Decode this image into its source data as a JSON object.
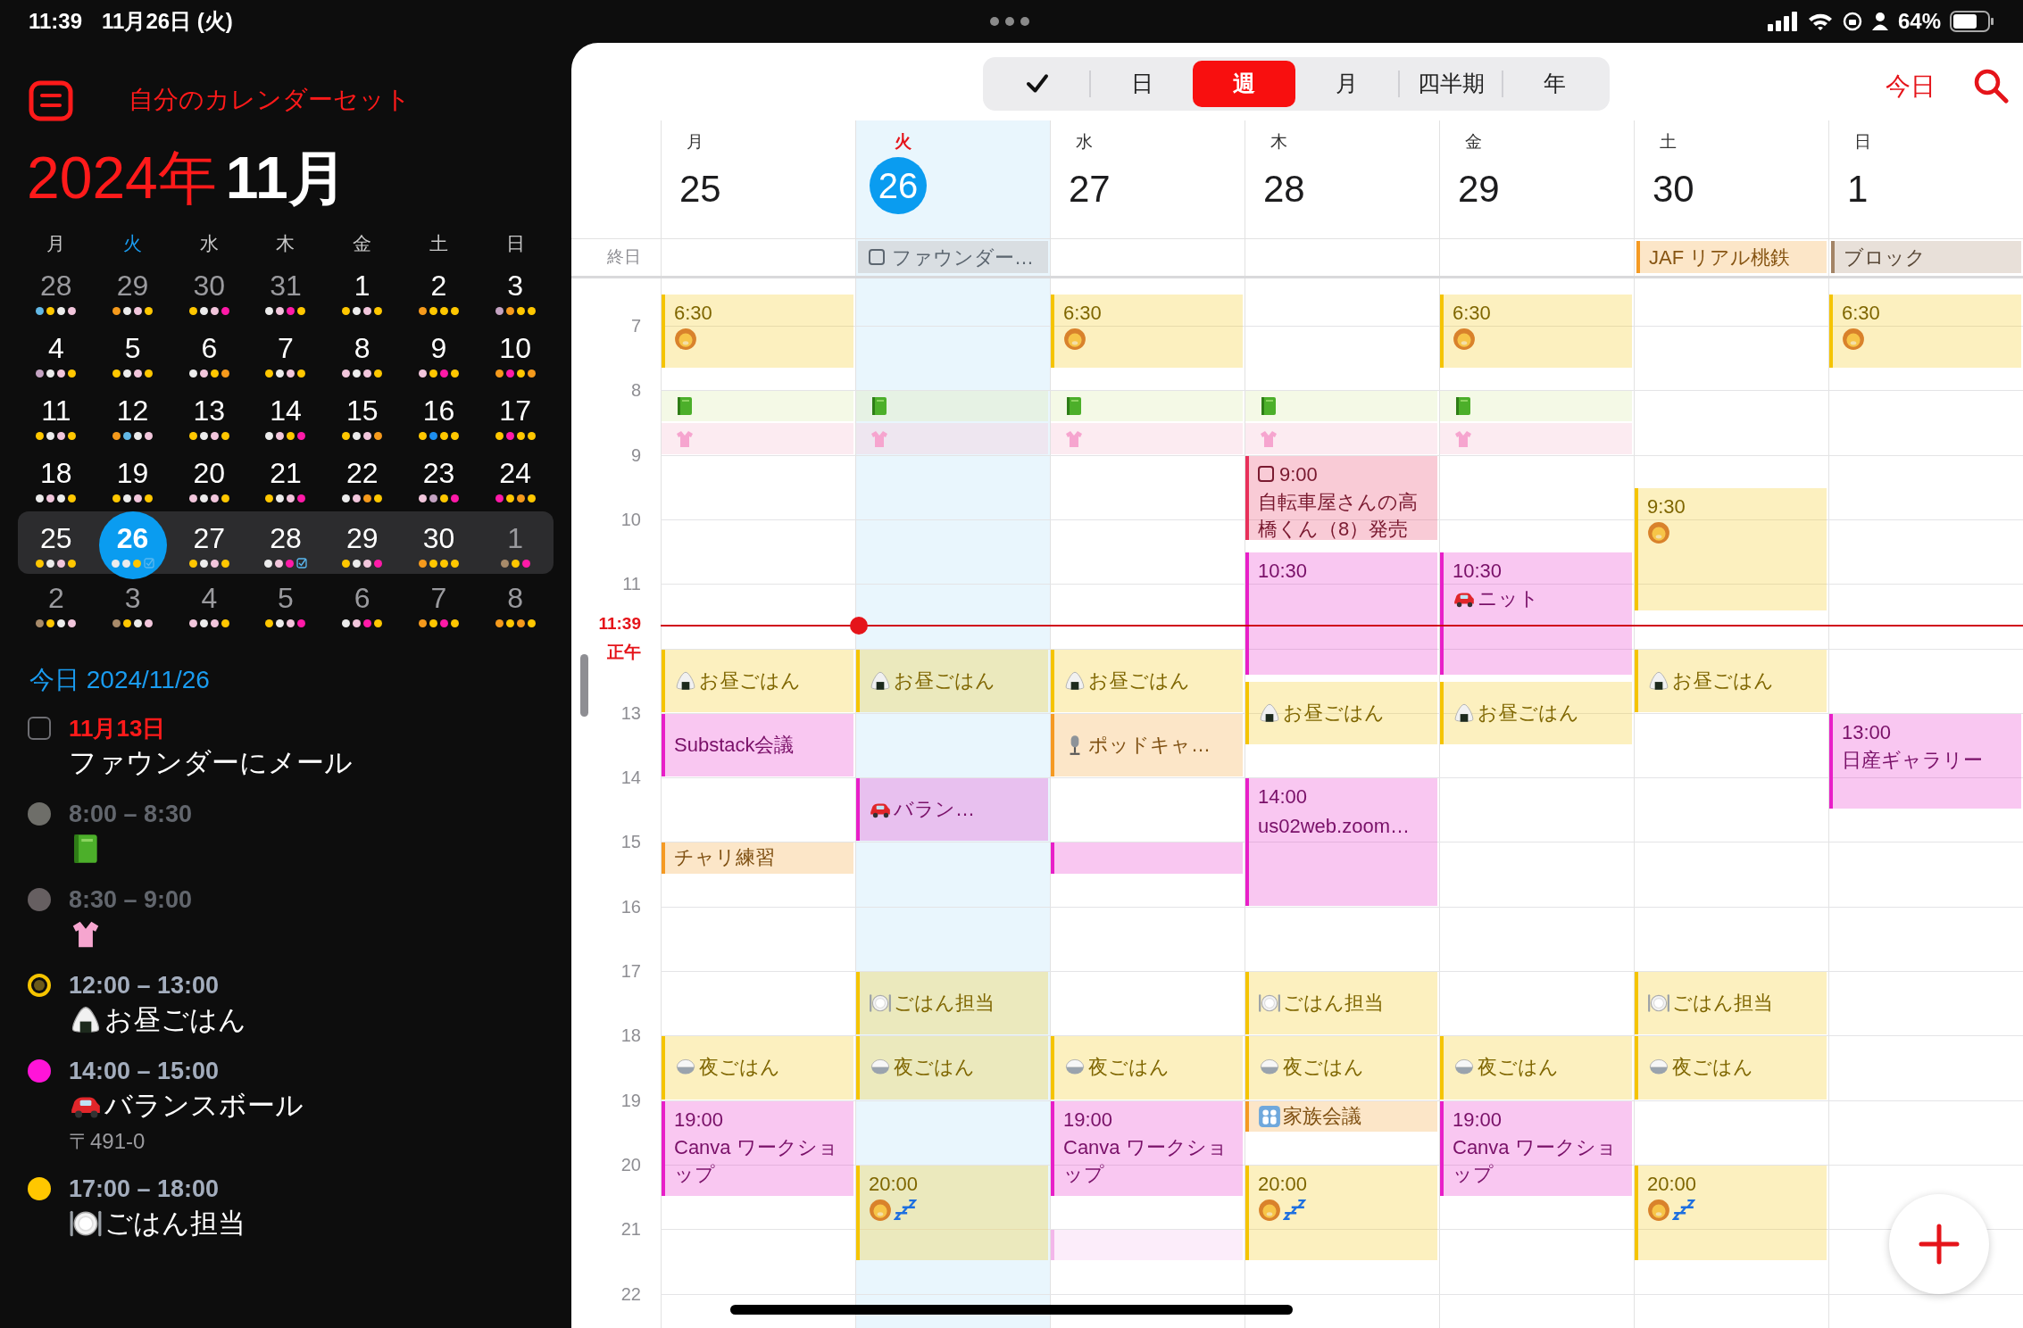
{
  "status_bar": {
    "time": "11:39",
    "date": "11月26日 (火)",
    "battery": "64%"
  },
  "sidebar": {
    "calendar_set": "自分のカレンダーセット",
    "year": "2024年",
    "month": "11月",
    "weekdays": [
      {
        "label": "月",
        "today": false
      },
      {
        "label": "火",
        "today": true
      },
      {
        "label": "水",
        "today": false
      },
      {
        "label": "木",
        "today": false
      },
      {
        "label": "金",
        "today": false
      },
      {
        "label": "土",
        "today": false
      },
      {
        "label": "日",
        "today": false
      }
    ],
    "weeks": [
      {
        "selected": false,
        "days": [
          {
            "label": "28",
            "other_month": true,
            "today": false,
            "task": false,
            "dots": [
              {
                "color": "#62b8e6"
              },
              {
                "color": "#ffc700"
              },
              {
                "color": "#ececec"
              },
              {
                "color": "#f2c6dc"
              }
            ]
          },
          {
            "label": "29",
            "other_month": true,
            "today": false,
            "task": false,
            "dots": [
              {
                "color": "#f59a1c"
              },
              {
                "color": "#ececec"
              },
              {
                "color": "#f2c6dc"
              },
              {
                "color": "#ffc700"
              }
            ]
          },
          {
            "label": "30",
            "other_month": true,
            "today": false,
            "task": false,
            "dots": [
              {
                "color": "#ffc700"
              },
              {
                "color": "#ececec"
              },
              {
                "color": "#f2c6dc"
              },
              {
                "color": "#ff1aa8"
              }
            ]
          },
          {
            "label": "31",
            "other_month": true,
            "today": false,
            "task": false,
            "dots": [
              {
                "color": "#ececec"
              },
              {
                "color": "#f2c6dc"
              },
              {
                "color": "#ff1aa8"
              },
              {
                "color": "#ffc700"
              }
            ]
          },
          {
            "label": "1",
            "other_month": false,
            "today": false,
            "task": false,
            "dots": [
              {
                "color": "#ffc700"
              },
              {
                "color": "#ececec"
              },
              {
                "color": "#f2c6dc"
              },
              {
                "color": "#ffc700"
              }
            ]
          },
          {
            "label": "2",
            "other_month": false,
            "today": false,
            "task": false,
            "dots": [
              {
                "color": "#f59a1c"
              },
              {
                "color": "#ffc700"
              },
              {
                "color": "#ffc700"
              },
              {
                "color": "#ffc700"
              }
            ]
          },
          {
            "label": "3",
            "other_month": false,
            "today": false,
            "task": false,
            "dots": [
              {
                "color": "#c4a3c2"
              },
              {
                "color": "#f59a1c"
              },
              {
                "color": "#ffc700"
              },
              {
                "color": "#ffc700"
              }
            ]
          }
        ]
      },
      {
        "selected": false,
        "days": [
          {
            "label": "4",
            "other_month": false,
            "today": false,
            "task": false,
            "dots": [
              {
                "color": "#c4a3c2"
              },
              {
                "color": "#ececec"
              },
              {
                "color": "#f2c6dc"
              },
              {
                "color": "#ffc700"
              }
            ]
          },
          {
            "label": "5",
            "other_month": false,
            "today": false,
            "task": false,
            "dots": [
              {
                "color": "#ffc700"
              },
              {
                "color": "#ececec"
              },
              {
                "color": "#f2c6dc"
              },
              {
                "color": "#ffc700"
              }
            ]
          },
          {
            "label": "6",
            "other_month": false,
            "today": false,
            "task": false,
            "dots": [
              {
                "color": "#ececec"
              },
              {
                "color": "#f2c6dc"
              },
              {
                "color": "#ffc700"
              },
              {
                "color": "#f59a1c"
              }
            ]
          },
          {
            "label": "7",
            "other_month": false,
            "today": false,
            "task": false,
            "dots": [
              {
                "color": "#ffc700"
              },
              {
                "color": "#ececec"
              },
              {
                "color": "#f2c6dc"
              },
              {
                "color": "#ffc700"
              }
            ]
          },
          {
            "label": "8",
            "other_month": false,
            "today": false,
            "task": false,
            "dots": [
              {
                "color": "#f2c6dc"
              },
              {
                "color": "#ececec"
              },
              {
                "color": "#f2c6dc"
              },
              {
                "color": "#ffc700"
              }
            ]
          },
          {
            "label": "9",
            "other_month": false,
            "today": false,
            "task": false,
            "dots": [
              {
                "color": "#f2c6dc"
              },
              {
                "color": "#ffc700"
              },
              {
                "color": "#ff1aa8"
              },
              {
                "color": "#ffc700"
              }
            ]
          },
          {
            "label": "10",
            "other_month": false,
            "today": false,
            "task": false,
            "dots": [
              {
                "color": "#f59a1c"
              },
              {
                "color": "#ff1aa8"
              },
              {
                "color": "#ffc700"
              },
              {
                "color": "#f59a1c"
              }
            ]
          }
        ]
      },
      {
        "selected": false,
        "days": [
          {
            "label": "11",
            "other_month": false,
            "today": false,
            "task": false,
            "dots": [
              {
                "color": "#ffc700"
              },
              {
                "color": "#ececec"
              },
              {
                "color": "#f2c6dc"
              },
              {
                "color": "#ffc700"
              }
            ]
          },
          {
            "label": "12",
            "other_month": false,
            "today": false,
            "task": false,
            "dots": [
              {
                "color": "#f59a1c"
              },
              {
                "color": "#62b8e6"
              },
              {
                "color": "#ececec"
              },
              {
                "color": "#f2c6dc"
              }
            ]
          },
          {
            "label": "13",
            "other_month": false,
            "today": false,
            "task": false,
            "dots": [
              {
                "color": "#ffc700"
              },
              {
                "color": "#ececec"
              },
              {
                "color": "#f2c6dc"
              },
              {
                "color": "#ffc700"
              }
            ]
          },
          {
            "label": "14",
            "other_month": false,
            "today": false,
            "task": false,
            "dots": [
              {
                "color": "#ececec"
              },
              {
                "color": "#f2c6dc"
              },
              {
                "color": "#ffc700"
              },
              {
                "color": "#ff1aa8"
              }
            ]
          },
          {
            "label": "15",
            "other_month": false,
            "today": false,
            "task": false,
            "dots": [
              {
                "color": "#ffc700"
              },
              {
                "color": "#ececec"
              },
              {
                "color": "#f2c6dc"
              },
              {
                "color": "#f59a1c"
              }
            ]
          },
          {
            "label": "16",
            "other_month": false,
            "today": false,
            "task": false,
            "dots": [
              {
                "color": "#ffc700"
              },
              {
                "color": "#1e8ff0"
              },
              {
                "color": "#ffc700"
              },
              {
                "color": "#ffc700"
              }
            ]
          },
          {
            "label": "17",
            "other_month": false,
            "today": false,
            "task": false,
            "dots": [
              {
                "color": "#ffc700"
              },
              {
                "color": "#ff1aa8"
              },
              {
                "color": "#ffc700"
              },
              {
                "color": "#ffc700"
              }
            ]
          }
        ]
      },
      {
        "selected": false,
        "days": [
          {
            "label": "18",
            "other_month": false,
            "today": false,
            "task": false,
            "dots": [
              {
                "color": "#ececec"
              },
              {
                "color": "#f2c6dc"
              },
              {
                "color": "#ececec"
              },
              {
                "color": "#ffc700"
              }
            ]
          },
          {
            "label": "19",
            "other_month": false,
            "today": false,
            "task": false,
            "dots": [
              {
                "color": "#ffc700"
              },
              {
                "color": "#ececec"
              },
              {
                "color": "#f2c6dc"
              },
              {
                "color": "#ffc700"
              }
            ]
          },
          {
            "label": "20",
            "other_month": false,
            "today": false,
            "task": false,
            "dots": [
              {
                "color": "#f2c6dc"
              },
              {
                "color": "#ececec"
              },
              {
                "color": "#f2c6dc"
              },
              {
                "color": "#ffc700"
              }
            ]
          },
          {
            "label": "21",
            "other_month": false,
            "today": false,
            "task": false,
            "dots": [
              {
                "color": "#ffc700"
              },
              {
                "color": "#ececec"
              },
              {
                "color": "#f2c6dc"
              },
              {
                "color": "#ff1aa8"
              }
            ]
          },
          {
            "label": "22",
            "other_month": false,
            "today": false,
            "task": false,
            "dots": [
              {
                "color": "#ececec"
              },
              {
                "color": "#f2c6dc"
              },
              {
                "color": "#f59a1c"
              },
              {
                "color": "#ffc700"
              }
            ]
          },
          {
            "label": "23",
            "other_month": false,
            "today": false,
            "task": false,
            "dots": [
              {
                "color": "#f2c6dc"
              },
              {
                "color": "#c4a3c2"
              },
              {
                "color": "#ffc700"
              },
              {
                "color": "#ff1aa8"
              }
            ]
          },
          {
            "label": "24",
            "other_month": false,
            "today": false,
            "task": false,
            "dots": [
              {
                "color": "#ff1aa8"
              },
              {
                "color": "#ffc700"
              },
              {
                "color": "#f59a1c"
              },
              {
                "color": "#ffc700"
              }
            ]
          }
        ]
      },
      {
        "selected": true,
        "days": [
          {
            "label": "25",
            "other_month": false,
            "today": false,
            "task": false,
            "dots": [
              {
                "color": "#ffc700"
              },
              {
                "color": "#ececec"
              },
              {
                "color": "#f2c6dc"
              },
              {
                "color": "#ffc700"
              }
            ]
          },
          {
            "label": "26",
            "other_month": false,
            "today": true,
            "task": true,
            "dots": [
              {
                "color": "#ececec"
              },
              {
                "color": "#ececec"
              },
              {
                "color": "#ffc700"
              }
            ]
          },
          {
            "label": "27",
            "other_month": false,
            "today": false,
            "task": false,
            "dots": [
              {
                "color": "#ffc700"
              },
              {
                "color": "#ececec"
              },
              {
                "color": "#f2c6dc"
              },
              {
                "color": "#ffc700"
              }
            ]
          },
          {
            "label": "28",
            "other_month": false,
            "today": false,
            "task": true,
            "dots": [
              {
                "color": "#ececec"
              },
              {
                "color": "#f2c6dc"
              },
              {
                "color": "#ff1aa8"
              }
            ]
          },
          {
            "label": "29",
            "other_month": false,
            "today": false,
            "task": false,
            "dots": [
              {
                "color": "#ffc700"
              },
              {
                "color": "#ececec"
              },
              {
                "color": "#f2c6dc"
              },
              {
                "color": "#ff1aa8"
              }
            ]
          },
          {
            "label": "30",
            "other_month": false,
            "today": false,
            "task": false,
            "dots": [
              {
                "color": "#f59a1c"
              },
              {
                "color": "#ffc700"
              },
              {
                "color": "#ffc700"
              },
              {
                "color": "#ffc700"
              }
            ]
          },
          {
            "label": "1",
            "other_month": true,
            "today": false,
            "task": false,
            "dots": [
              {
                "color": "#a88b6a"
              },
              {
                "color": "#ffc700"
              },
              {
                "color": "#ff1aa8"
              }
            ]
          }
        ]
      },
      {
        "selected": false,
        "days": [
          {
            "label": "2",
            "other_month": true,
            "today": false,
            "task": false,
            "dots": [
              {
                "color": "#a88b6a"
              },
              {
                "color": "#ffc700"
              },
              {
                "color": "#ececec"
              },
              {
                "color": "#f2c6dc"
              }
            ]
          },
          {
            "label": "3",
            "other_month": true,
            "today": false,
            "task": false,
            "dots": [
              {
                "color": "#a88b6a"
              },
              {
                "color": "#ffc700"
              },
              {
                "color": "#ececec"
              },
              {
                "color": "#f2c6dc"
              }
            ]
          },
          {
            "label": "4",
            "other_month": true,
            "today": false,
            "task": false,
            "dots": [
              {
                "color": "#f2c6dc"
              },
              {
                "color": "#ececec"
              },
              {
                "color": "#f2c6dc"
              },
              {
                "color": "#ffc700"
              }
            ]
          },
          {
            "label": "5",
            "other_month": true,
            "today": false,
            "task": false,
            "dots": [
              {
                "color": "#ffc700"
              },
              {
                "color": "#ececec"
              },
              {
                "color": "#f2c6dc"
              },
              {
                "color": "#ff1aa8"
              }
            ]
          },
          {
            "label": "6",
            "other_month": true,
            "today": false,
            "task": false,
            "dots": [
              {
                "color": "#ececec"
              },
              {
                "color": "#f2c6dc"
              },
              {
                "color": "#ff1aa8"
              },
              {
                "color": "#ffc700"
              }
            ]
          },
          {
            "label": "7",
            "other_month": true,
            "today": false,
            "task": false,
            "dots": [
              {
                "color": "#f59a1c"
              },
              {
                "color": "#ffc700"
              },
              {
                "color": "#ff1aa8"
              },
              {
                "color": "#ffc700"
              }
            ]
          },
          {
            "label": "8",
            "other_month": true,
            "today": false,
            "task": false,
            "dots": [
              {
                "color": "#f59a1c"
              },
              {
                "color": "#ffc700"
              },
              {
                "color": "#f59a1c"
              },
              {
                "color": "#ffc700"
              }
            ]
          }
        ]
      }
    ],
    "agenda_header": "今日 2024/11/26",
    "agenda": [
      {
        "kind": "task",
        "checked": false,
        "date": "11月13日",
        "title": "ファウンダーにメール"
      },
      {
        "kind": "event",
        "time": "8:00 – 8:30",
        "color": "#6e6e69",
        "past": true,
        "current": false
      },
      {
        "kind": "event",
        "time": "8:30 – 9:00",
        "color": "#665f61",
        "past": true,
        "current": false
      },
      {
        "kind": "event",
        "time": "12:00 – 13:00",
        "color": "#f5c400",
        "past": false,
        "current": true,
        "title": "お昼ごはん"
      },
      {
        "kind": "event",
        "time": "14:00 – 15:00",
        "color": "#ff14d8",
        "past": false,
        "current": false,
        "title": "バランスボール",
        "location": "〒491-0"
      },
      {
        "kind": "event",
        "time": "17:00 – 18:00",
        "color": "#ffc700",
        "past": false,
        "current": false,
        "title": "ごはん担当"
      }
    ]
  },
  "toolbar": {
    "views": [
      {
        "kind": "icon",
        "selected": false
      },
      {
        "kind": "text",
        "label": "日",
        "selected": false
      },
      {
        "kind": "text",
        "label": "週",
        "selected": true
      },
      {
        "kind": "text",
        "label": "月",
        "selected": false
      },
      {
        "kind": "text",
        "label": "四半期",
        "selected": false
      },
      {
        "kind": "text",
        "label": "年",
        "selected": false
      }
    ],
    "today_button": "今日"
  },
  "week": {
    "all_day_label": "終日",
    "hours": [
      "7",
      "8",
      "9",
      "10",
      "11",
      "正午",
      "13",
      "14",
      "15",
      "16",
      "17",
      "18",
      "19",
      "20",
      "21",
      "22"
    ],
    "now_label": "11:39",
    "days": [
      {
        "weekday": "月",
        "date": "25",
        "today": false,
        "events": [
          {
            "kind": "timed",
            "color": "#f5c400",
            "time": "6:30"
          },
          {
            "kind": "strip",
            "color": "#f4f9e6"
          },
          {
            "kind": "strip",
            "color": "#fcebf1"
          },
          {
            "kind": "timed",
            "color": "#f5c400",
            "title": "お昼ごはん"
          },
          {
            "kind": "timed",
            "color": "#e81fc8",
            "title": "Substack会議"
          },
          {
            "kind": "timed",
            "color": "#f59a23",
            "title": "チャリ練習"
          },
          {
            "kind": "timed",
            "color": "#f5c400",
            "title": "夜ごはん"
          },
          {
            "kind": "timed",
            "color": "#e81fc8",
            "time": "19:00",
            "title": "Canva ワークショップ"
          }
        ]
      },
      {
        "weekday": "火",
        "date": "26",
        "today": true,
        "all_day": [
          {
            "kind": "task",
            "checked": false,
            "title": "ファウンダー…",
            "color": "#d9dee2"
          }
        ],
        "events": [
          {
            "kind": "strip",
            "color": "#e6f2e4"
          },
          {
            "kind": "strip",
            "color": "#eee6f0"
          },
          {
            "kind": "timed",
            "color": "#f5c400",
            "title": "お昼ごはん"
          },
          {
            "kind": "timed",
            "color": "#e81fc8",
            "title": "バラン…"
          },
          {
            "kind": "timed",
            "color": "#f5c400",
            "title": "ごはん担当"
          },
          {
            "kind": "timed",
            "color": "#f5c400",
            "title": "夜ごはん"
          },
          {
            "kind": "timed",
            "color": "#f5c400",
            "time": "20:00"
          }
        ]
      },
      {
        "weekday": "水",
        "date": "27",
        "today": false,
        "events": [
          {
            "kind": "timed",
            "color": "#f5c400",
            "time": "6:30"
          },
          {
            "kind": "strip",
            "color": "#f4f9e6"
          },
          {
            "kind": "strip",
            "color": "#fcebf1"
          },
          {
            "kind": "timed",
            "color": "#f5c400",
            "title": "お昼ごはん"
          },
          {
            "kind": "timed",
            "color": "#f59a23",
            "title": "ポッドキャ…"
          },
          {
            "kind": "timed",
            "color": "#e81fc8"
          },
          {
            "kind": "timed",
            "color": "#f5c400",
            "title": "夜ごはん"
          },
          {
            "kind": "timed",
            "color": "#e81fc8",
            "time": "19:00",
            "title": "Canva ワークショップ"
          },
          {
            "kind": "timed",
            "color": "#f3b6ea"
          }
        ]
      },
      {
        "weekday": "木",
        "date": "28",
        "today": false,
        "events": [
          {
            "kind": "strip",
            "color": "#f4f9e6"
          },
          {
            "kind": "strip",
            "color": "#fcebf1"
          },
          {
            "kind": "task",
            "checked": false,
            "color": "#e8305a",
            "time": "9:00",
            "title": "自転車屋さんの高橋くん（8）発売"
          },
          {
            "kind": "timed",
            "color": "#e81fc8",
            "time": "10:30"
          },
          {
            "kind": "timed",
            "color": "#f5c400",
            "title": "お昼ごはん"
          },
          {
            "kind": "timed",
            "color": "#e81fc8",
            "time": "14:00",
            "note": "us02web.zoom…"
          },
          {
            "kind": "timed",
            "color": "#f5c400",
            "title": "ごはん担当"
          },
          {
            "kind": "timed",
            "color": "#f5c400",
            "title": "夜ごはん"
          },
          {
            "kind": "timed",
            "color": "#f59a23",
            "title": "家族会議"
          },
          {
            "kind": "timed",
            "color": "#f5c400",
            "time": "20:00"
          }
        ]
      },
      {
        "weekday": "金",
        "date": "29",
        "today": false,
        "events": [
          {
            "kind": "timed",
            "color": "#f5c400",
            "time": "6:30"
          },
          {
            "kind": "strip",
            "color": "#f4f9e6"
          },
          {
            "kind": "strip",
            "color": "#fcebf1"
          },
          {
            "kind": "timed",
            "color": "#e81fc8",
            "time": "10:30",
            "title": "ニット"
          },
          {
            "kind": "timed",
            "color": "#f5c400",
            "title": "お昼ごはん"
          },
          {
            "kind": "timed",
            "color": "#f5c400",
            "title": "夜ごはん"
          },
          {
            "kind": "timed",
            "color": "#e81fc8",
            "time": "19:00",
            "title": "Canva ワークショップ"
          }
        ]
      },
      {
        "weekday": "土",
        "date": "30",
        "today": false,
        "all_day": [
          {
            "kind": "event",
            "title": "JAF リアル桃鉄",
            "color": "#f59a23"
          }
        ],
        "events": [
          {
            "kind": "timed",
            "color": "#f5c400",
            "time": "9:30"
          },
          {
            "kind": "timed",
            "color": "#f5c400",
            "title": "お昼ごはん"
          },
          {
            "kind": "timed",
            "color": "#f5c400",
            "title": "ごはん担当"
          },
          {
            "kind": "timed",
            "color": "#f5c400",
            "title": "夜ごはん"
          },
          {
            "kind": "timed",
            "color": "#f5c400",
            "time": "20:00"
          }
        ]
      },
      {
        "weekday": "日",
        "date": "1",
        "today": false,
        "all_day": [
          {
            "kind": "event",
            "title": "ブロック",
            "color": "#a38466"
          }
        ],
        "events": [
          {
            "kind": "timed",
            "color": "#f5c400",
            "time": "6:30"
          },
          {
            "kind": "timed",
            "color": "#e81fc8",
            "time": "13:00",
            "title": "日産ギャラリー"
          }
        ]
      }
    ]
  }
}
